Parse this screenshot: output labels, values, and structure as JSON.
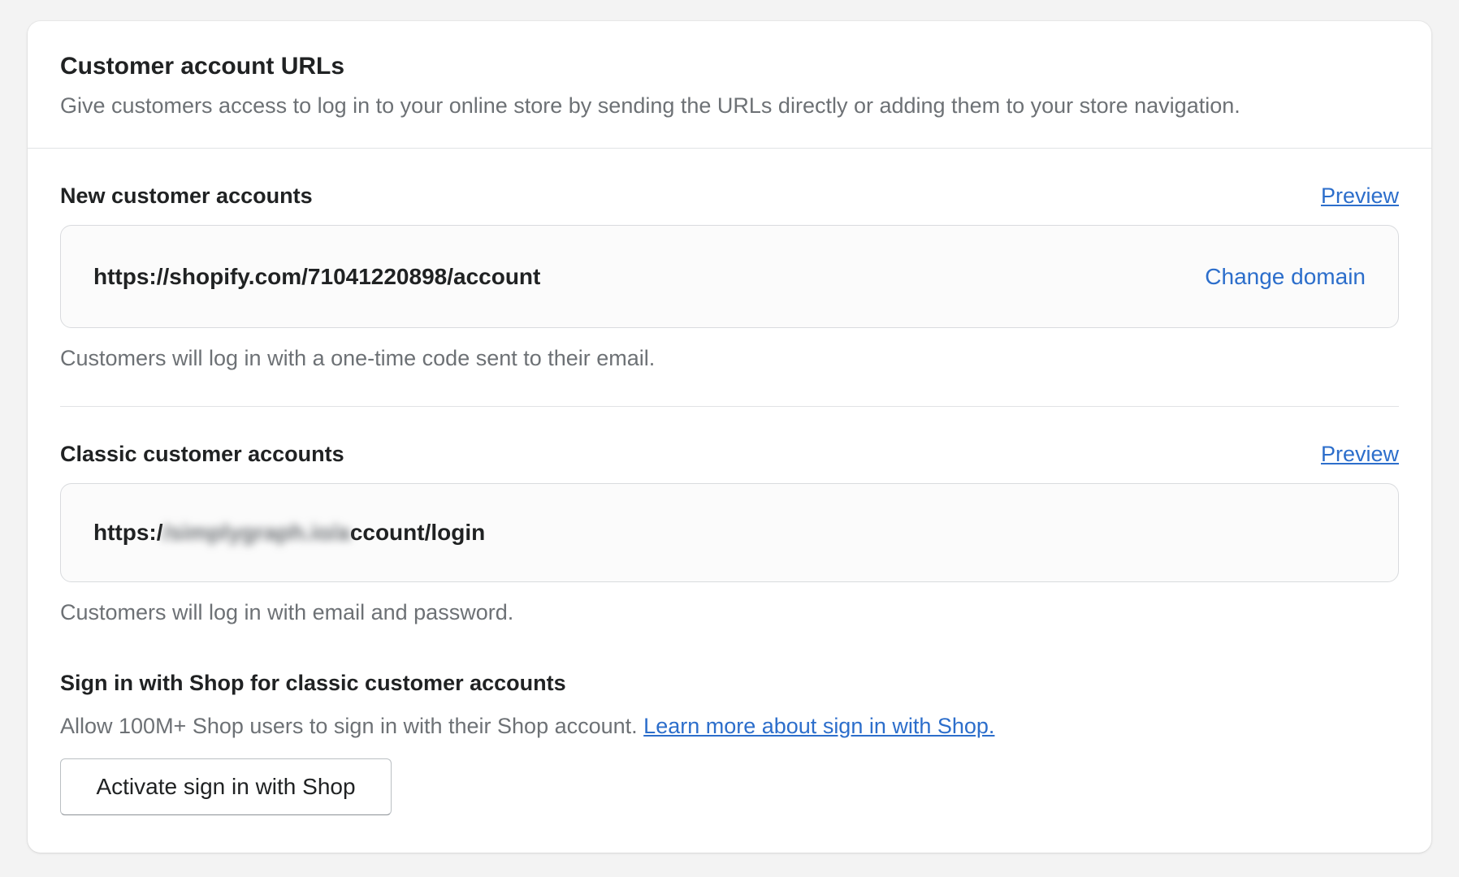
{
  "card": {
    "title": "Customer account URLs",
    "subtitle": "Give customers access to log in to your online store by sending the URLs directly or adding them to your store navigation."
  },
  "new_accounts": {
    "title": "New customer accounts",
    "preview_label": "Preview",
    "url": "https://shopify.com/71041220898/account",
    "change_domain_label": "Change domain",
    "helper": "Customers will log in with a one-time code sent to their email."
  },
  "classic_accounts": {
    "title": "Classic customer accounts",
    "preview_label": "Preview",
    "url_prefix": "https:/",
    "url_blurred": "/simplygraph.io/a",
    "url_suffix": "ccount/login",
    "helper": "Customers will log in with email and password."
  },
  "shop_signin": {
    "title": "Sign in with Shop for classic customer accounts",
    "description": "Allow 100M+ Shop users to sign in with their Shop account.",
    "learn_more_label": "Learn more about sign in with Shop.",
    "activate_label": "Activate sign in with Shop"
  },
  "colors": {
    "link": "#2c6ecb",
    "text": "#202223",
    "subdued": "#6d7175",
    "background": "#f3f3f3"
  }
}
